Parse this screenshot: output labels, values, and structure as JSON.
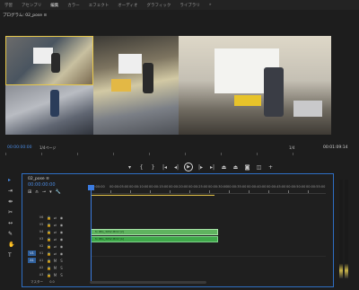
{
  "topnav": [
    "学習",
    "アセンブリ",
    "編集",
    "カラー",
    "エフェクト",
    "オーディオ",
    "グラフィック",
    "ライブラリ",
    "»"
  ],
  "topnav_active": "編集",
  "monitor": {
    "tab_label": "プログラム: 02_pose ≡",
    "timecode_left": "00:00:00:00",
    "fit_label": "1/4ページ",
    "zoom_label": "1/4",
    "timecode_right": "00:01:09:14"
  },
  "transport": {
    "buttons": [
      "marker-icon",
      "in-point-icon",
      "out-point-icon",
      "go-to-in-icon",
      "step-back-icon",
      "play-icon",
      "step-forward-icon",
      "go-to-out-icon",
      "lift-icon",
      "extract-icon",
      "export-frame-icon",
      "compare-icon",
      "button-editor-icon"
    ]
  },
  "sequence": {
    "tab_label": "02_pose ≡",
    "timecode": "00:00:00:00",
    "ruler": [
      "00:00:00",
      "00:00:05:00",
      "00:00:10:00",
      "00:00:15:00",
      "00:00:20:00",
      "00:00:25:00",
      "00:00:30:00",
      "00:00:35:00",
      "00:00:40:00",
      "00:00:45:00",
      "00:00:50:00",
      "00:00:55:00"
    ],
    "video_tracks": [
      "V6",
      "V5",
      "V4",
      "V3",
      "V2",
      "V1"
    ],
    "audio_tracks": [
      "A1",
      "A2",
      "A3"
    ],
    "master_label": "マスター",
    "master_value": "0.0",
    "clip_video_label": "fx   IMG_3052.MOV [V]",
    "clip_audio_label": "fx   IMG_3052.MOV [A]"
  },
  "colors": {
    "accent": "#2e6fc4",
    "clip_green": "#3fa84a",
    "playhead": "#3b7be0",
    "timecode": "#4a8ae0",
    "yellow_border": "#e7c84a"
  }
}
